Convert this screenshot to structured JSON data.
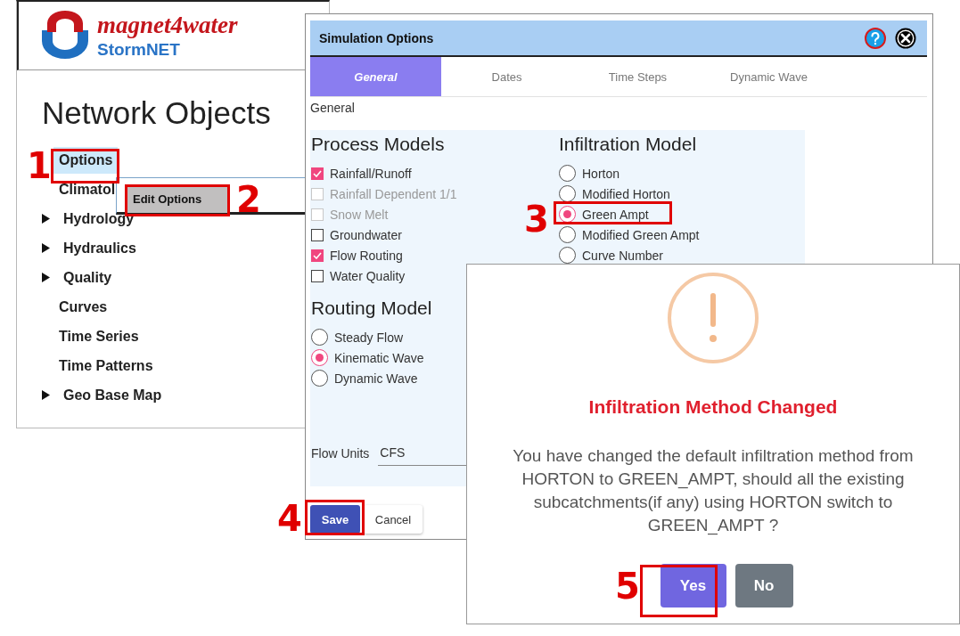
{
  "sidebar": {
    "logo": {
      "brand": "magnet4water",
      "product": "StormNET"
    },
    "title": "Network Objects",
    "items": [
      {
        "label": "Options",
        "expandable": false,
        "selected": true
      },
      {
        "label": "Climatol",
        "expandable": false,
        "selected": false
      },
      {
        "label": "Hydrology",
        "expandable": true,
        "selected": false
      },
      {
        "label": "Hydraulics",
        "expandable": true,
        "selected": false
      },
      {
        "label": "Quality",
        "expandable": true,
        "selected": false
      },
      {
        "label": "Curves",
        "expandable": false,
        "selected": false
      },
      {
        "label": "Time Series",
        "expandable": false,
        "selected": false
      },
      {
        "label": "Time Patterns",
        "expandable": false,
        "selected": false
      },
      {
        "label": "Geo Base Map",
        "expandable": true,
        "selected": false
      }
    ]
  },
  "context_menu": {
    "items": [
      {
        "label": "Edit Options",
        "selected": true
      }
    ]
  },
  "simulation_options": {
    "title": "Simulation Options",
    "tabs": [
      {
        "label": "General",
        "selected": true
      },
      {
        "label": "Dates",
        "selected": false
      },
      {
        "label": "Time Steps",
        "selected": false
      },
      {
        "label": "Dynamic Wave",
        "selected": false
      }
    ],
    "section_label": "General",
    "process_models": {
      "heading": "Process Models",
      "items": [
        {
          "label": "Rainfall/Runoff",
          "checked": true,
          "disabled": false
        },
        {
          "label": "Rainfall Dependent 1/1",
          "checked": false,
          "disabled": true
        },
        {
          "label": "Snow Melt",
          "checked": false,
          "disabled": true
        },
        {
          "label": "Groundwater",
          "checked": false,
          "disabled": false
        },
        {
          "label": "Flow Routing",
          "checked": true,
          "disabled": false
        },
        {
          "label": "Water Quality",
          "checked": false,
          "disabled": false
        }
      ]
    },
    "infiltration_model": {
      "heading": "Infiltration Model",
      "options": [
        {
          "label": "Horton",
          "selected": false
        },
        {
          "label": "Modified Horton",
          "selected": false
        },
        {
          "label": "Green Ampt",
          "selected": true
        },
        {
          "label": "Modified Green Ampt",
          "selected": false
        },
        {
          "label": "Curve Number",
          "selected": false
        }
      ]
    },
    "routing_model": {
      "heading": "Routing Model",
      "options": [
        {
          "label": "Steady Flow",
          "selected": false
        },
        {
          "label": "Kinematic Wave",
          "selected": true
        },
        {
          "label": "Dynamic Wave",
          "selected": false
        }
      ]
    },
    "flow_units": {
      "label": "Flow Units",
      "value": "CFS"
    },
    "buttons": [
      {
        "label": "Save",
        "kind": "primary"
      },
      {
        "label": "Cancel",
        "kind": "secondary"
      }
    ]
  },
  "alert": {
    "title": "Infiltration Method Changed",
    "message": "You have changed the default infiltration method from HORTON to GREEN_AMPT, should all the existing subcatchments(if any) using HORTON switch to GREEN_AMPT ?",
    "buttons": [
      {
        "label": "Yes",
        "kind": "confirm"
      },
      {
        "label": "No",
        "kind": "cancel"
      }
    ]
  },
  "annotations": [
    {
      "label": "1"
    },
    {
      "label": "2"
    },
    {
      "label": "3"
    },
    {
      "label": "4"
    },
    {
      "label": "5"
    }
  ]
}
